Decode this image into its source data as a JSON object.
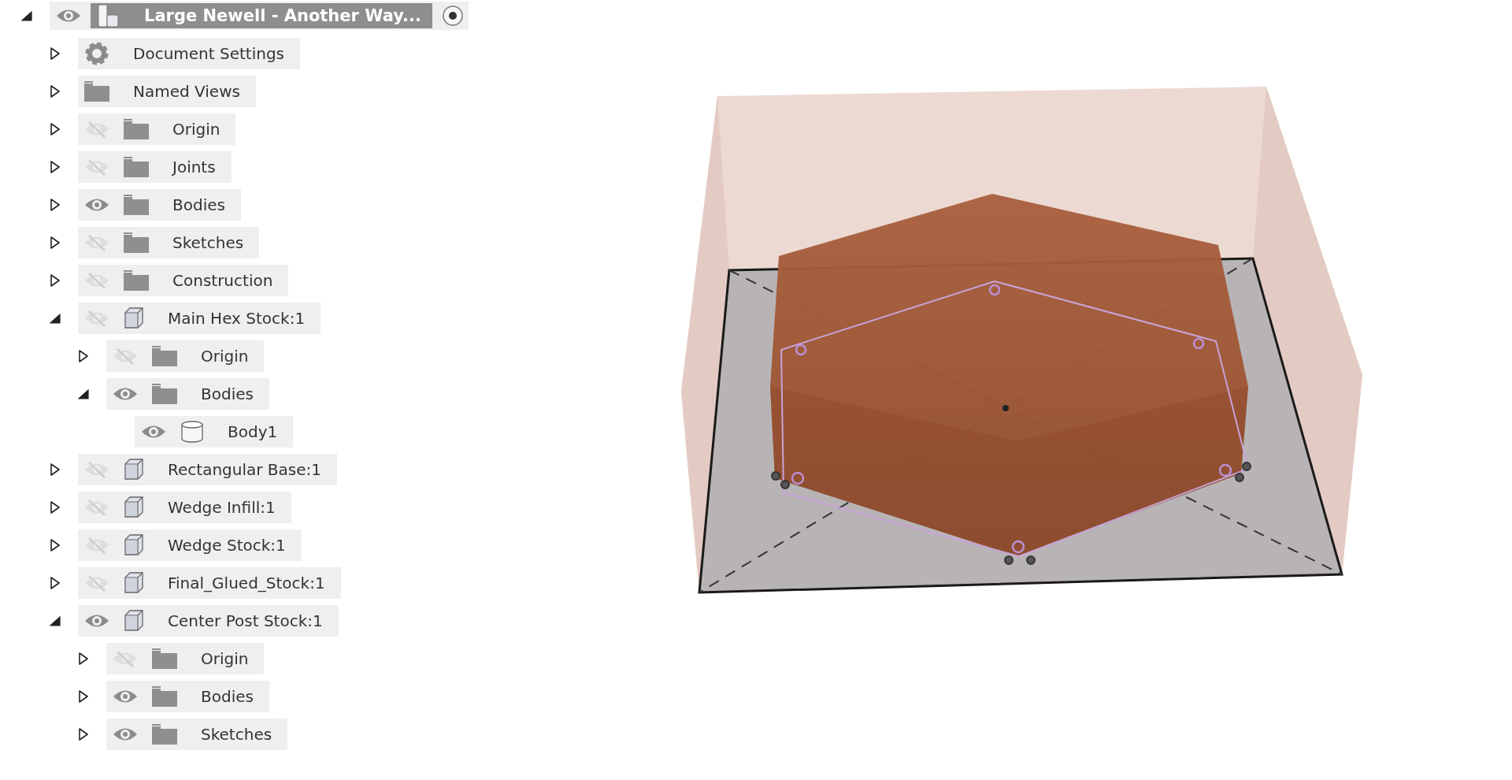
{
  "browser": {
    "label": "Large Newell - Another Way...",
    "kind": "root",
    "visible": true,
    "expanded": true,
    "selected": true,
    "active": true,
    "children": [
      {
        "label": "Document Settings",
        "kind": "settings",
        "expanded": false,
        "selected": false
      },
      {
        "label": "Named Views",
        "kind": "folder",
        "expanded": false,
        "selected": false
      },
      {
        "label": "Origin",
        "kind": "folder",
        "visible": false,
        "expanded": false,
        "selected": false
      },
      {
        "label": "Joints",
        "kind": "folder",
        "visible": false,
        "expanded": false,
        "selected": false
      },
      {
        "label": "Bodies",
        "kind": "folder",
        "visible": true,
        "expanded": false,
        "selected": false
      },
      {
        "label": "Sketches",
        "kind": "folder",
        "visible": false,
        "expanded": false,
        "selected": false
      },
      {
        "label": "Construction",
        "kind": "folder",
        "visible": false,
        "expanded": false,
        "selected": false
      },
      {
        "label": "Main Hex Stock:1",
        "kind": "component",
        "visible": false,
        "expanded": true,
        "selected": false,
        "children": [
          {
            "label": "Origin",
            "kind": "folder",
            "visible": false,
            "expanded": false,
            "selected": false
          },
          {
            "label": "Bodies",
            "kind": "folder",
            "visible": true,
            "expanded": true,
            "selected": false,
            "children": [
              {
                "label": "Body1",
                "kind": "body",
                "visible": true,
                "selected": false
              }
            ]
          }
        ]
      },
      {
        "label": "Rectangular Base:1",
        "kind": "component",
        "visible": false,
        "expanded": false,
        "selected": false
      },
      {
        "label": "Wedge Infill:1",
        "kind": "component",
        "visible": false,
        "expanded": false,
        "selected": false
      },
      {
        "label": "Wedge Stock:1",
        "kind": "component",
        "visible": false,
        "expanded": false,
        "selected": false
      },
      {
        "label": "Final_Glued_Stock:1",
        "kind": "component",
        "visible": false,
        "expanded": false,
        "selected": false
      },
      {
        "label": "Center Post Stock:1",
        "kind": "component",
        "visible": true,
        "expanded": true,
        "selected": false,
        "children": [
          {
            "label": "Origin",
            "kind": "folder",
            "visible": false,
            "expanded": false,
            "selected": false
          },
          {
            "label": "Bodies",
            "kind": "folder",
            "visible": true,
            "expanded": false,
            "selected": false
          },
          {
            "label": "Sketches",
            "kind": "folder",
            "visible": true,
            "expanded": false,
            "selected": false
          }
        ]
      }
    ]
  }
}
